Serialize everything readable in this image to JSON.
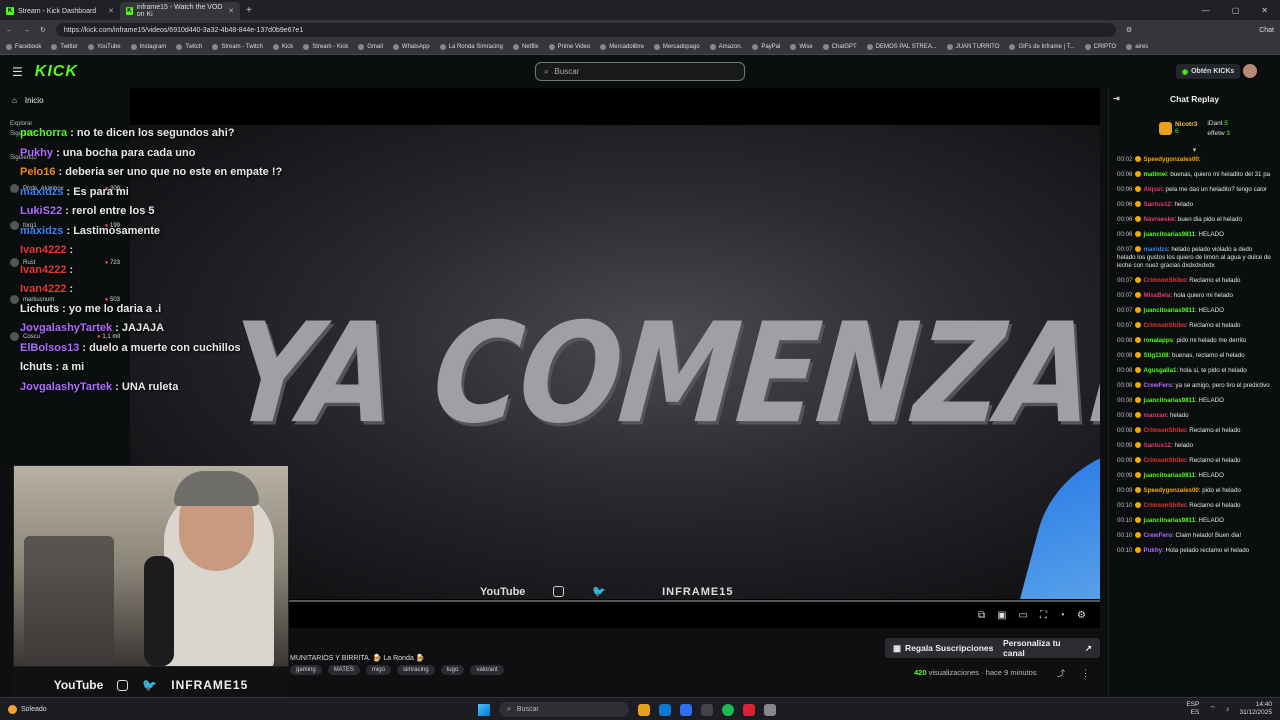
{
  "browser": {
    "tabs": [
      {
        "label": "Stream - Kick Dashboard",
        "active": false
      },
      {
        "label": "inframe15 - Watch the VOD on Ki",
        "active": true
      }
    ],
    "url": "https://kick.com/inframe15/videos/6910d440-3a32-4b48-844e-137d0b9e67e1",
    "chat_button": "Chat",
    "bookmarks": [
      "Facebook",
      "Twitter",
      "YouTube",
      "Instagram",
      "Twitch",
      "Stream - Twitch",
      "Kick",
      "Stream - Kick",
      "Gmail",
      "WhatsApp",
      "La Ronda Simracing",
      "Netflix",
      "Prime Video",
      "Mercadolibre",
      "Mercadopago",
      "Amazon.",
      "PayPal",
      "Wise",
      "ChatGPT",
      "DEMOS PAL STREA...",
      "JUAN TURRITO",
      "GIFs de Inframe | T...",
      "CRIPTO",
      "aires"
    ]
  },
  "kick": {
    "logo": "KICK",
    "search_placeholder": "Buscar",
    "kicks_button": "Obtén KICKs"
  },
  "sidebar": {
    "nav": [
      "Inicio",
      "Explorar",
      "Siguiendo"
    ],
    "section": "Siguiendo",
    "channels": [
      {
        "name": "Profe_Akimbox",
        "viewers": "309"
      },
      {
        "name": "forg1",
        "viewers": "199"
      },
      {
        "name": "Rust",
        "viewers": "723"
      },
      {
        "name": "markusnum",
        "viewers": "503"
      },
      {
        "name": "Coscu",
        "viewers": "1,1 mil"
      }
    ]
  },
  "video": {
    "title_text": "YA COMENZAMOS",
    "strip": {
      "youtube": "YouTube",
      "brand": "INFRAME15"
    },
    "progress": 0.02,
    "overlay_chat": [
      {
        "user": "pachorra",
        "color": "#53fc18",
        "text": ": no te dicen los segundos ahi?"
      },
      {
        "user": "Pukhy",
        "color": "#b06cff",
        "text": ": una bocha para cada uno"
      },
      {
        "user": "Pelo16",
        "color": "#f28a1a",
        "text": ": deberia ser uno que no este en empate !?"
      },
      {
        "user": "maxidzs",
        "color": "#3b82f6",
        "text": ": Es para mi"
      },
      {
        "user": "LukiS22",
        "color": "#b06cff",
        "text": ": rerol entre los 5"
      },
      {
        "user": "maxidzs",
        "color": "#3b82f6",
        "text": ": Lastimosamente"
      },
      {
        "user": "Ivan4222",
        "color": "#e53935",
        "text": ":"
      },
      {
        "user": "Ivan4222",
        "color": "#e53935",
        "text": ":"
      },
      {
        "user": "Ivan4222",
        "color": "#e53935",
        "text": ":"
      },
      {
        "user": "Lichuts",
        "color": "#eeeeee",
        "text": ": yo me lo daria a .i"
      },
      {
        "user": "JovgalashyTartek",
        "color": "#b06cff",
        "text": ": JAJAJA"
      },
      {
        "user": "ElBolsos13",
        "color": "#b06cff",
        "text": ": duelo a muerte con cuchillos"
      },
      {
        "user": "lchuts",
        "color": "#eeeeee",
        "text": ": a mi"
      },
      {
        "user": "JovgalashyTartek",
        "color": "#b06cff",
        "text": ": UNA ruleta"
      }
    ]
  },
  "webcam": {
    "youtube": "YouTube",
    "brand": "INFRAME15"
  },
  "below": {
    "title": "MUNITARIOS Y BIRRITA. 🍺 La Ronda 🍺",
    "tags": [
      "gaming",
      "MATES",
      "migo",
      "simracing",
      "tugo",
      "valorant"
    ],
    "subs_button": "Regala Suscripciones",
    "channel_button": "Personaliza tu canal",
    "views_count": "420",
    "views_text": "visualizaciones · hace 9 minutos"
  },
  "chat": {
    "title": "Chat Replay",
    "leaders": {
      "main": {
        "name": "Nicotr3",
        "count": "6"
      },
      "others": [
        {
          "name": "iDant",
          "count": "5"
        },
        {
          "name": "effetw",
          "count": "3"
        }
      ]
    },
    "messages": [
      {
        "time": "00:02",
        "user": "Speedygonzales00",
        "color": "#f2a900",
        "text": ":"
      },
      {
        "time": "00:06",
        "user": "matimei",
        "color": "#53fc18",
        "text": ": buenas, quiero mi heladito del 31 pa"
      },
      {
        "time": "00:06",
        "user": "Alqssi",
        "color": "#e53977",
        "text": ": pela me das un heladito? tengo calor"
      },
      {
        "time": "00:06",
        "user": "Santus12",
        "color": "#e53977",
        "text": ": helado"
      },
      {
        "time": "00:06",
        "user": "Navraeske",
        "color": "#e53977",
        "text": ": buen dia pido el helado"
      },
      {
        "time": "00:06",
        "user": "juancitoarias9811",
        "color": "#53fc18",
        "text": ": HELADO"
      },
      {
        "time": "00:07",
        "user": "maxidzs",
        "color": "#3b82f6",
        "text": ": helado pelado violado a dedo helado los gustos los quiero de limon al agua y dulce de leche con nuez gracias dxdxdxdxdx"
      },
      {
        "time": "00:07",
        "user": "CrimsonShibo",
        "color": "#e53935",
        "text": ": Reclamo el helado"
      },
      {
        "time": "00:07",
        "user": "MissBela",
        "color": "#e53977",
        "text": ": hola quiero mi helado"
      },
      {
        "time": "00:07",
        "user": "juancitoarias9811",
        "color": "#53fc18",
        "text": ": HELADO"
      },
      {
        "time": "00:07",
        "user": "CrimsonShibo",
        "color": "#e53935",
        "text": ": Reclamo el helado"
      },
      {
        "time": "00:08",
        "user": "ronalapps",
        "color": "#53fc18",
        "text": ": pido mi helado me derrito"
      },
      {
        "time": "00:08",
        "user": "Stig1108",
        "color": "#53fc18",
        "text": ": buenas, reclamo el helado"
      },
      {
        "time": "00:08",
        "user": "Agusgalla1",
        "color": "#53fc18",
        "text": ": hola si, te pido el helado"
      },
      {
        "time": "00:08",
        "user": "CrewFero",
        "color": "#b06cff",
        "text": ": ya se amigo, pero tiro el predictivo"
      },
      {
        "time": "00:08",
        "user": "juancitoarias9811",
        "color": "#53fc18",
        "text": ": HELADO"
      },
      {
        "time": "00:08",
        "user": "manzan",
        "color": "#e53977",
        "text": ": helado"
      },
      {
        "time": "00:08",
        "user": "CrimsonShibo",
        "color": "#e53935",
        "text": ": Reclamo el helado"
      },
      {
        "time": "00:09",
        "user": "Santus12",
        "color": "#e53977",
        "text": ": helado"
      },
      {
        "time": "00:09",
        "user": "CrimsonShibo",
        "color": "#e53935",
        "text": ": Reclamo el helado"
      },
      {
        "time": "00:09",
        "user": "juancitoarias9811",
        "color": "#53fc18",
        "text": ": HELADO"
      },
      {
        "time": "00:09",
        "user": "Speedygonzales00",
        "color": "#f2a900",
        "text": ": pido el helado"
      },
      {
        "time": "00:10",
        "user": "CrimsonShibo",
        "color": "#e53935",
        "text": ": Reclamo el helado"
      },
      {
        "time": "00:10",
        "user": "juancitoarias9811",
        "color": "#53fc18",
        "text": ": HELADO"
      },
      {
        "time": "00:10",
        "user": "CrewFero",
        "color": "#b06cff",
        "text": ": Claim helado! Buen dia!"
      },
      {
        "time": "00:10",
        "user": "Pukhy",
        "color": "#b06cff",
        "text": ": Hola pelado reclamo el helado"
      }
    ]
  },
  "taskbar": {
    "weather": "Soleado",
    "search": "Buscar",
    "lang": "ESP",
    "lang2": "ES",
    "time": "14:40",
    "date": "31/12/2025"
  }
}
